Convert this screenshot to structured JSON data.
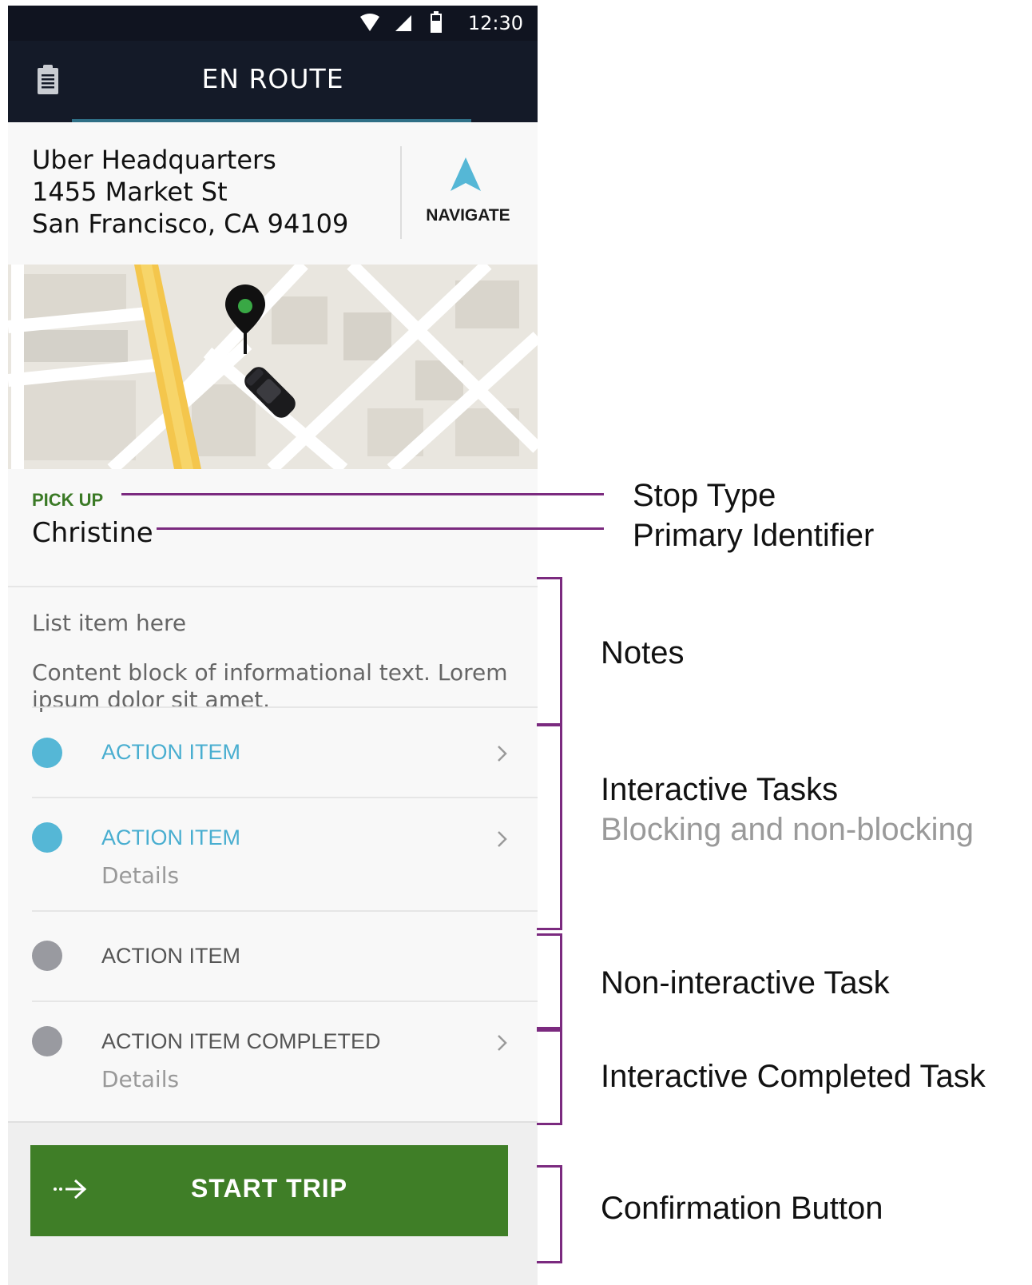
{
  "status_bar": {
    "time": "12:30"
  },
  "app_bar": {
    "title": "EN ROUTE"
  },
  "address": {
    "lines": [
      "Uber Headquarters",
      "1455 Market St",
      "San Francisco, CA 94109"
    ],
    "navigate_label": "NAVIGATE"
  },
  "stop": {
    "type": "PICK UP",
    "name": "Christine"
  },
  "notes": {
    "title": "List item here",
    "body": "Content block of informational text. Lorem ipsum dolor sit amet."
  },
  "tasks": [
    {
      "label": "ACTION ITEM",
      "details": "",
      "status": "interactive"
    },
    {
      "label": "ACTION ITEM",
      "details": "Details",
      "status": "interactive"
    },
    {
      "label": "ACTION ITEM",
      "details": "",
      "status": "non-interactive"
    },
    {
      "label": "ACTION ITEM COMPLETED",
      "details": "Details",
      "status": "completed"
    }
  ],
  "confirm_button": {
    "label": "START TRIP"
  },
  "annotations": {
    "stop_type": "Stop Type",
    "primary_identifier": "Primary Identifier",
    "notes": "Notes",
    "interactive_tasks": "Interactive Tasks",
    "interactive_tasks_sub": "Blocking and non-blocking",
    "non_interactive_task": "Non-interactive Task",
    "interactive_completed_task": "Interactive Completed Task",
    "confirmation_button": "Confirmation Button"
  },
  "colors": {
    "app_bar": "#141a28",
    "accent_blue": "#55b7d6",
    "pickup_green": "#3b7a26",
    "button_green": "#3f7e27",
    "annotation_purple": "#7b2a7f"
  }
}
